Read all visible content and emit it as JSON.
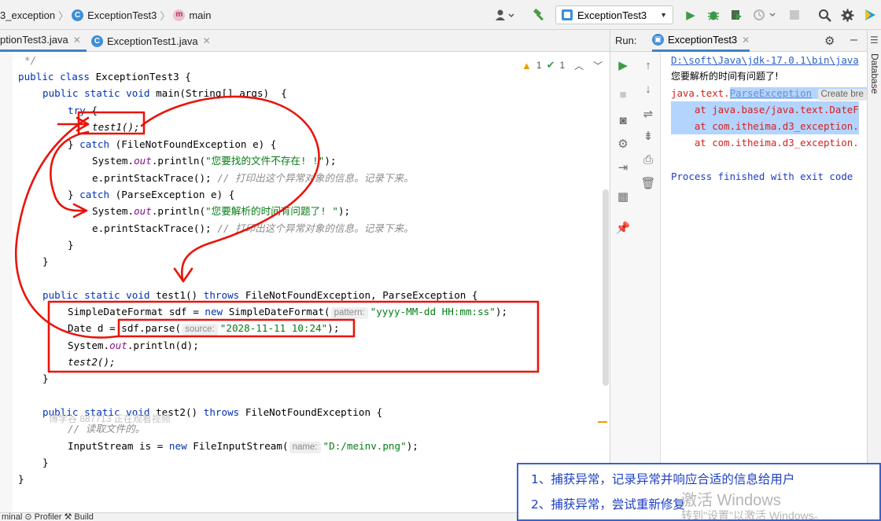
{
  "topbar": {
    "breadcrumb_project": "3_exception",
    "breadcrumb_class_icon": "C",
    "breadcrumb_class": "ExceptionTest3",
    "breadcrumb_method_icon": "m",
    "breadcrumb_method": "main",
    "run_config": "ExceptionTest3",
    "icons": [
      "user-icon",
      "hammer-build-icon",
      "run-icon",
      "debug-icon",
      "coverage-icon",
      "profile-icon",
      "stop-icon",
      "search-icon",
      "settings-gear-icon",
      "plugin-icon"
    ]
  },
  "tabs": [
    {
      "label": "ptionTest3.java",
      "active": true
    },
    {
      "label": "ExceptionTest1.java",
      "active": false
    }
  ],
  "editor": {
    "warnings": "1",
    "ok_count": "1",
    "lines": {
      "l0": "*/",
      "l1_a": "public class ",
      "l1_b": "ExceptionTest3 {",
      "l2_a": "public static void ",
      "l2_b": "main(String[] args)  {",
      "l3_a": "try",
      "l3_b": " {",
      "l4": "test1();",
      "l5_a": "} ",
      "l5_b": "catch",
      "l5_c": " (FileNotFoundException e) {",
      "l6_a": "System.",
      "l6_b": "out",
      "l6_c": ".println(",
      "l6_d": "\"您要找的文件不存在! !\"",
      "l6_e": ");",
      "l7_a": "e.printStackTrace(); ",
      "l7_b": "// 打印出这个异常对象的信息。记录下来。",
      "l8_a": "} ",
      "l8_b": "catch",
      "l8_c": " (ParseException e) {",
      "l9_a": "System.",
      "l9_b": "out",
      "l9_c": ".println(",
      "l9_d": "\"您要解析的时间有问题了! \"",
      "l9_e": ");",
      "l10_a": "e.printStackTrace(); ",
      "l10_b": "// 打印出这个异常对象的信息。记录下来。",
      "l11": "}",
      "l12": "}",
      "l13_a": "public static void ",
      "l13_b": "test1() ",
      "l13_c": "throws",
      "l13_d": " FileNotFoundException, ParseException {",
      "l14_a": "SimpleDateFormat sdf = ",
      "l14_b": "new",
      "l14_c": " SimpleDateFormat(",
      "l14_hint": "pattern:",
      "l14_d": "\"yyyy-MM-dd HH:mm:ss\"",
      "l14_e": ");",
      "l15_a": "Date d = sdf.parse(",
      "l15_hint": "source:",
      "l15_d": "\"2028-11-11 10:24\"",
      "l15_e": ");",
      "l16_a": "System.",
      "l16_b": "out",
      "l16_c": ".println(d);",
      "l17": "test2();",
      "l18": "}",
      "l19_a": "public static void ",
      "l19_b": "test2() ",
      "l19_c": "throws",
      "l19_d": " FileNotFoundException {",
      "l20": "// 读取文件的。",
      "l21_a": "InputStream is = ",
      "l21_b": "new",
      "l21_c": " FileInputStream(",
      "l21_hint": "name:",
      "l21_d": "\"D:/meinv.png\"",
      "l21_e": ");",
      "l22": "}",
      "l23": "}"
    }
  },
  "watermark": "博学谷 887713 正在观看视频",
  "run": {
    "label": "Run:",
    "tab": "ExceptionTest3",
    "console": {
      "c0": "D:\\soft\\Java\\jdk-17.0.1\\bin\\java",
      "c1": "您要解析的时间有问题了!",
      "c2_a": "java.text.",
      "c2_b": "ParseException",
      "c2_c": "Create bre",
      "c3": "    at java.base/java.text.DateF",
      "c4": "    at com.itheima.d3_exception.",
      "c5": "    at com.itheima.d3_exception.",
      "c6": "Process finished with exit code"
    }
  },
  "right_stripe": "Database",
  "bottom_strip": "minal    ⊙ Profiler    ⚒ Build",
  "notes": {
    "line1": "1、捕获异常，记录异常并响应合适的信息给用户",
    "line2": "2、捕获异常，尝试重新修复"
  },
  "activate": {
    "line1": "激活 Windows",
    "line2": "转到\"设置\"以激活 Windows。"
  },
  "colors": {
    "keyword": "#0033b3",
    "string": "#067d17",
    "field": "#871094",
    "comment": "#8c8c8c",
    "annotation": "#e8140c",
    "notes_text": "#1f3fc4"
  }
}
